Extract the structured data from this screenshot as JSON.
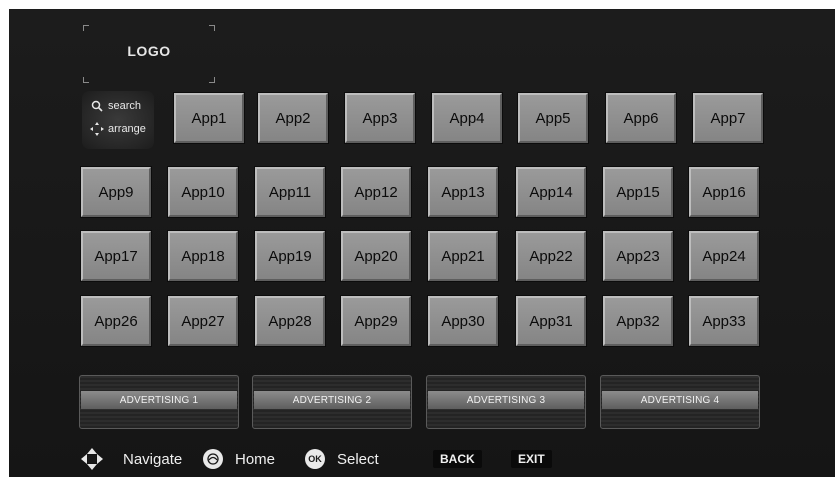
{
  "logo": {
    "text": "LOGO"
  },
  "tools": {
    "search": {
      "icon": "search-icon",
      "label": "search"
    },
    "arrange": {
      "icon": "arrange-icon",
      "label": "arrange"
    }
  },
  "apps": [
    "App1",
    "App2",
    "App3",
    "App4",
    "App5",
    "App6",
    "App7",
    "App9",
    "App10",
    "App11",
    "App12",
    "App13",
    "App14",
    "App15",
    "App16",
    "App17",
    "App18",
    "App19",
    "App20",
    "App21",
    "App22",
    "App23",
    "App24",
    "App26",
    "App27",
    "App28",
    "App29",
    "App30",
    "App31",
    "App32",
    "App33"
  ],
  "advertising": [
    "ADVERTISING 1",
    "ADVERTISING 2",
    "ADVERTISING 3",
    "ADVERTISING 4"
  ],
  "navbar": {
    "navigate": {
      "icon": "dpad-icon",
      "label": "Navigate"
    },
    "home": {
      "icon": "home-icon",
      "label": "Home"
    },
    "select": {
      "icon": "ok-icon",
      "icon_text": "OK",
      "label": "Select"
    },
    "back": "BACK",
    "exit": "EXIT"
  },
  "colors": {
    "background": "#1a1a1a",
    "tile": "#909090",
    "tile_text": "#0b0b0b"
  }
}
